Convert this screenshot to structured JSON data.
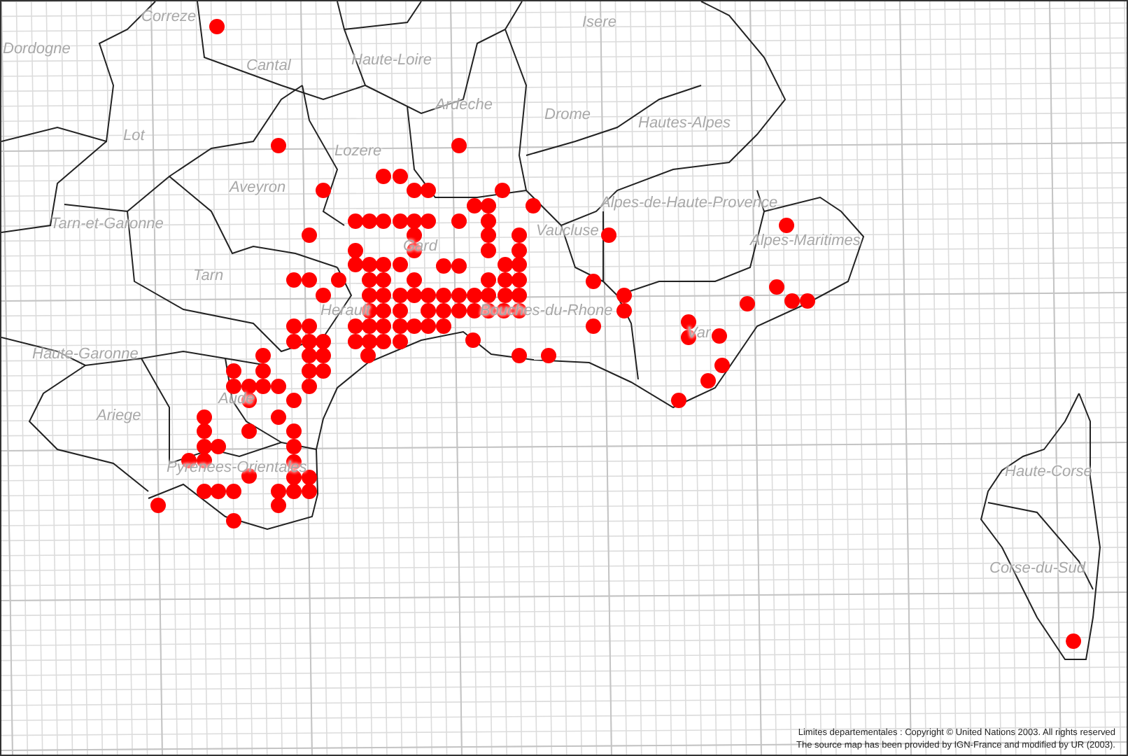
{
  "map": {
    "department_labels": [
      {
        "text": "Correze"
      },
      {
        "text": "Dordogne"
      },
      {
        "text": "Cantal"
      },
      {
        "text": "Haute-Loire"
      },
      {
        "text": "Ardeche"
      },
      {
        "text": "Drome"
      },
      {
        "text": "Isere"
      },
      {
        "text": "Hautes-Alpes"
      },
      {
        "text": "Lot"
      },
      {
        "text": "Lozere"
      },
      {
        "text": "Aveyron"
      },
      {
        "text": "Tarn-et-Garonne"
      },
      {
        "text": "Alpes-de-Haute-Provence"
      },
      {
        "text": "Vaucluse"
      },
      {
        "text": "Gard"
      },
      {
        "text": "Alpes-Maritimes"
      },
      {
        "text": "Tarn"
      },
      {
        "text": "Herault"
      },
      {
        "text": "Bouches-du-Rhone"
      },
      {
        "text": "Var"
      },
      {
        "text": "Haute-Garonne"
      },
      {
        "text": "Aude"
      },
      {
        "text": "Ariege"
      },
      {
        "text": "Pyrenees-Orientales"
      },
      {
        "text": "Haute-Corse"
      },
      {
        "text": "Corse-du-Sud"
      }
    ],
    "attribution": [
      "Limites departementales : Copyright © United Nations 2003. All rights reserved",
      "The source map has been provided by IGN-France and modified by UR (2003)."
    ]
  }
}
